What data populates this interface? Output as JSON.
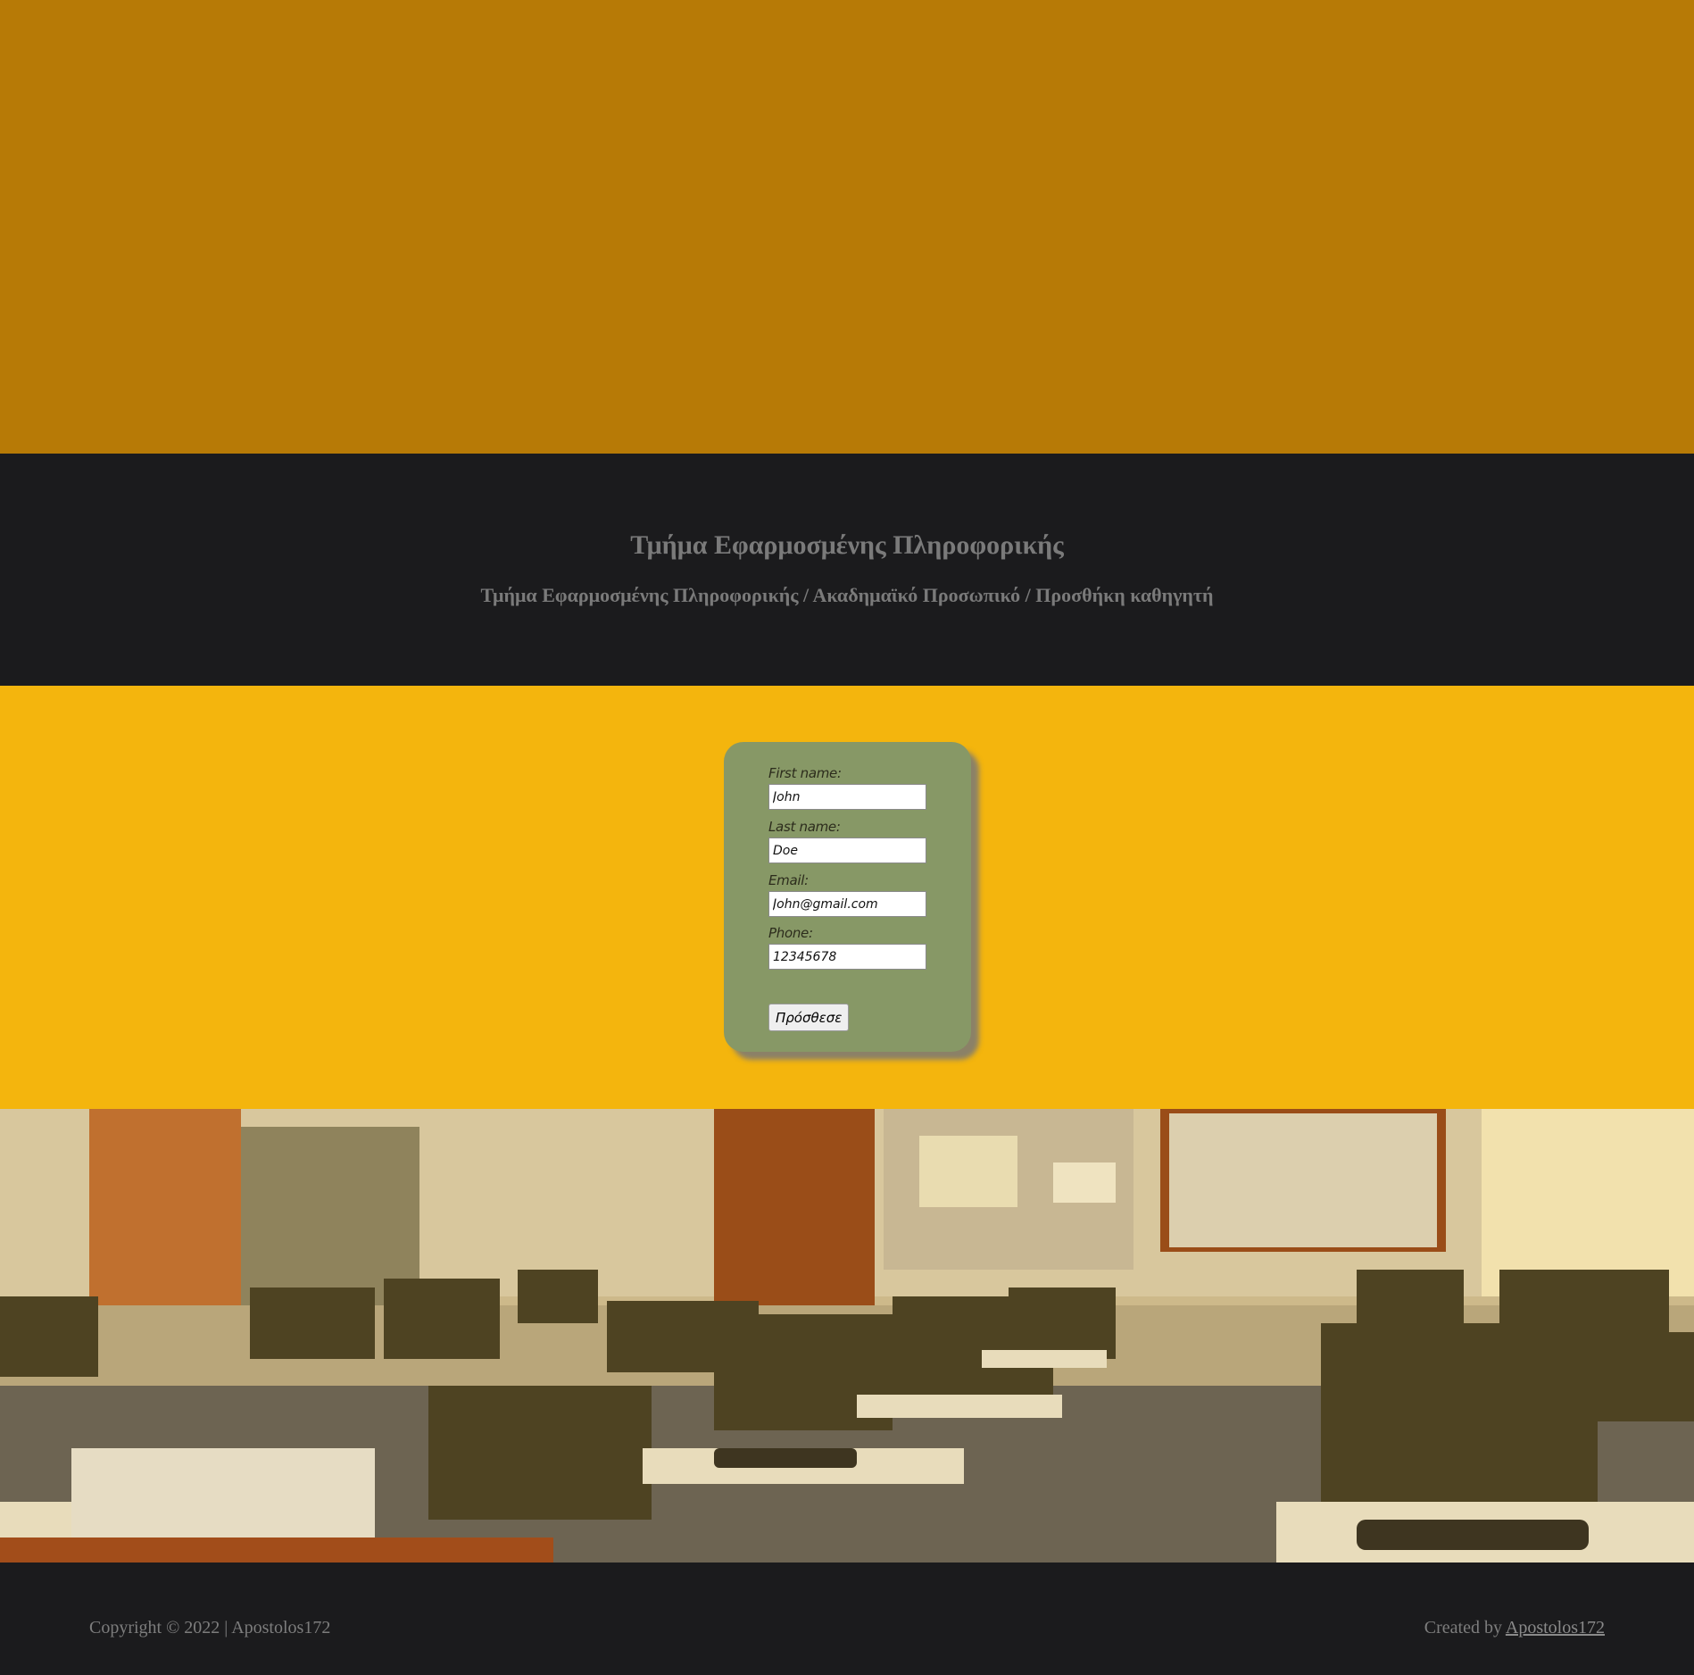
{
  "header": {
    "title": "Τμήμα Εφαρμοσμένης Πληροφορικής",
    "breadcrumb": "Τμήμα Εφαρμοσμένης Πληροφορικής / Ακαδημαϊκό Προσωπικό / Προσθήκη καθηγητή"
  },
  "form": {
    "first_name_label": "First name:",
    "first_name_value": "John",
    "last_name_label": "Last name:",
    "last_name_value": "Doe",
    "email_label": "Email:",
    "email_value": "John@gmail.com",
    "phone_label": "Phone:",
    "phone_value": "12345678",
    "submit_label": "Πρόσθεσε"
  },
  "footer": {
    "copyright": "Copyright © 2022 | Apostolos172",
    "created_by_prefix": "Created by ",
    "created_by_link": "Apostolos172"
  },
  "colors": {
    "top_band": "#b77a06",
    "dark": "#1b1b1d",
    "form_band": "#f4b50d",
    "form_card": "#879866"
  },
  "image": {
    "subject": "computer-lab-photo"
  }
}
